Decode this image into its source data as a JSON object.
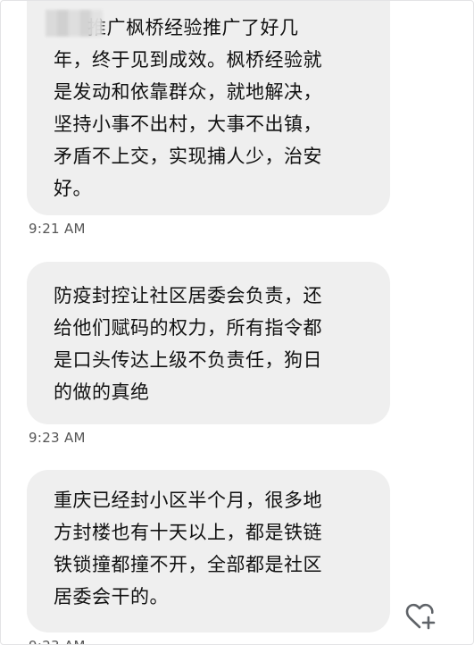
{
  "messages": [
    {
      "lines": [
        "推广枫桥经验推广了好几",
        "年，终于见到成效。枫桥经验就",
        "是发动和依靠群众，就地解决，",
        "坚持小事不出村，大事不出镇，",
        "矛盾不上交，实现捕人少，治安",
        "好。"
      ],
      "time": "9:21 AM"
    },
    {
      "lines": [
        "防疫封控让社区居委会负责，还",
        "给他们赋码的权力，所有指令都",
        "是口头传达上级不负责任，狗日",
        "的做的真绝"
      ],
      "time": "9:23 AM"
    },
    {
      "lines": [
        "重庆已经封小区半个月，很多地",
        "方封楼也有十天以上，都是铁链",
        "铁锁撞都撞不开，全部都是社区",
        "居委会干的。"
      ],
      "time": "9:23 AM"
    }
  ],
  "icons": {
    "react": "heart-plus-icon"
  }
}
